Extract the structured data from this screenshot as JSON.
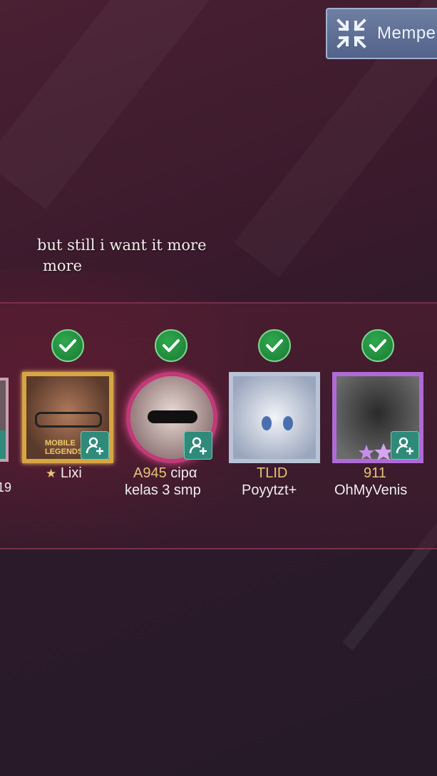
{
  "top_button": {
    "label": "Mempe",
    "icon": "shrink-arrows-icon"
  },
  "caption": {
    "line1": "but still i want it more",
    "line2": "more"
  },
  "left_partial": {
    "name_fragment": "19"
  },
  "players": [
    {
      "ready": true,
      "tag": "★",
      "name": "Lixi",
      "badge": "MOBILE LEGENDS",
      "frame": "gold"
    },
    {
      "ready": true,
      "tag": "A945",
      "name_inline": "cipα",
      "name": "kelas 3 smp",
      "frame": "pink"
    },
    {
      "ready": true,
      "tag": "TLID",
      "name": "Poyytzt+",
      "frame": "silver"
    },
    {
      "ready": true,
      "tag": "911",
      "name": "OhMyVenis",
      "frame": "purple"
    }
  ],
  "colors": {
    "ready_green": "#2fa84e",
    "add_teal": "#2f8a7a",
    "squad_tag": "#e7c27a"
  }
}
